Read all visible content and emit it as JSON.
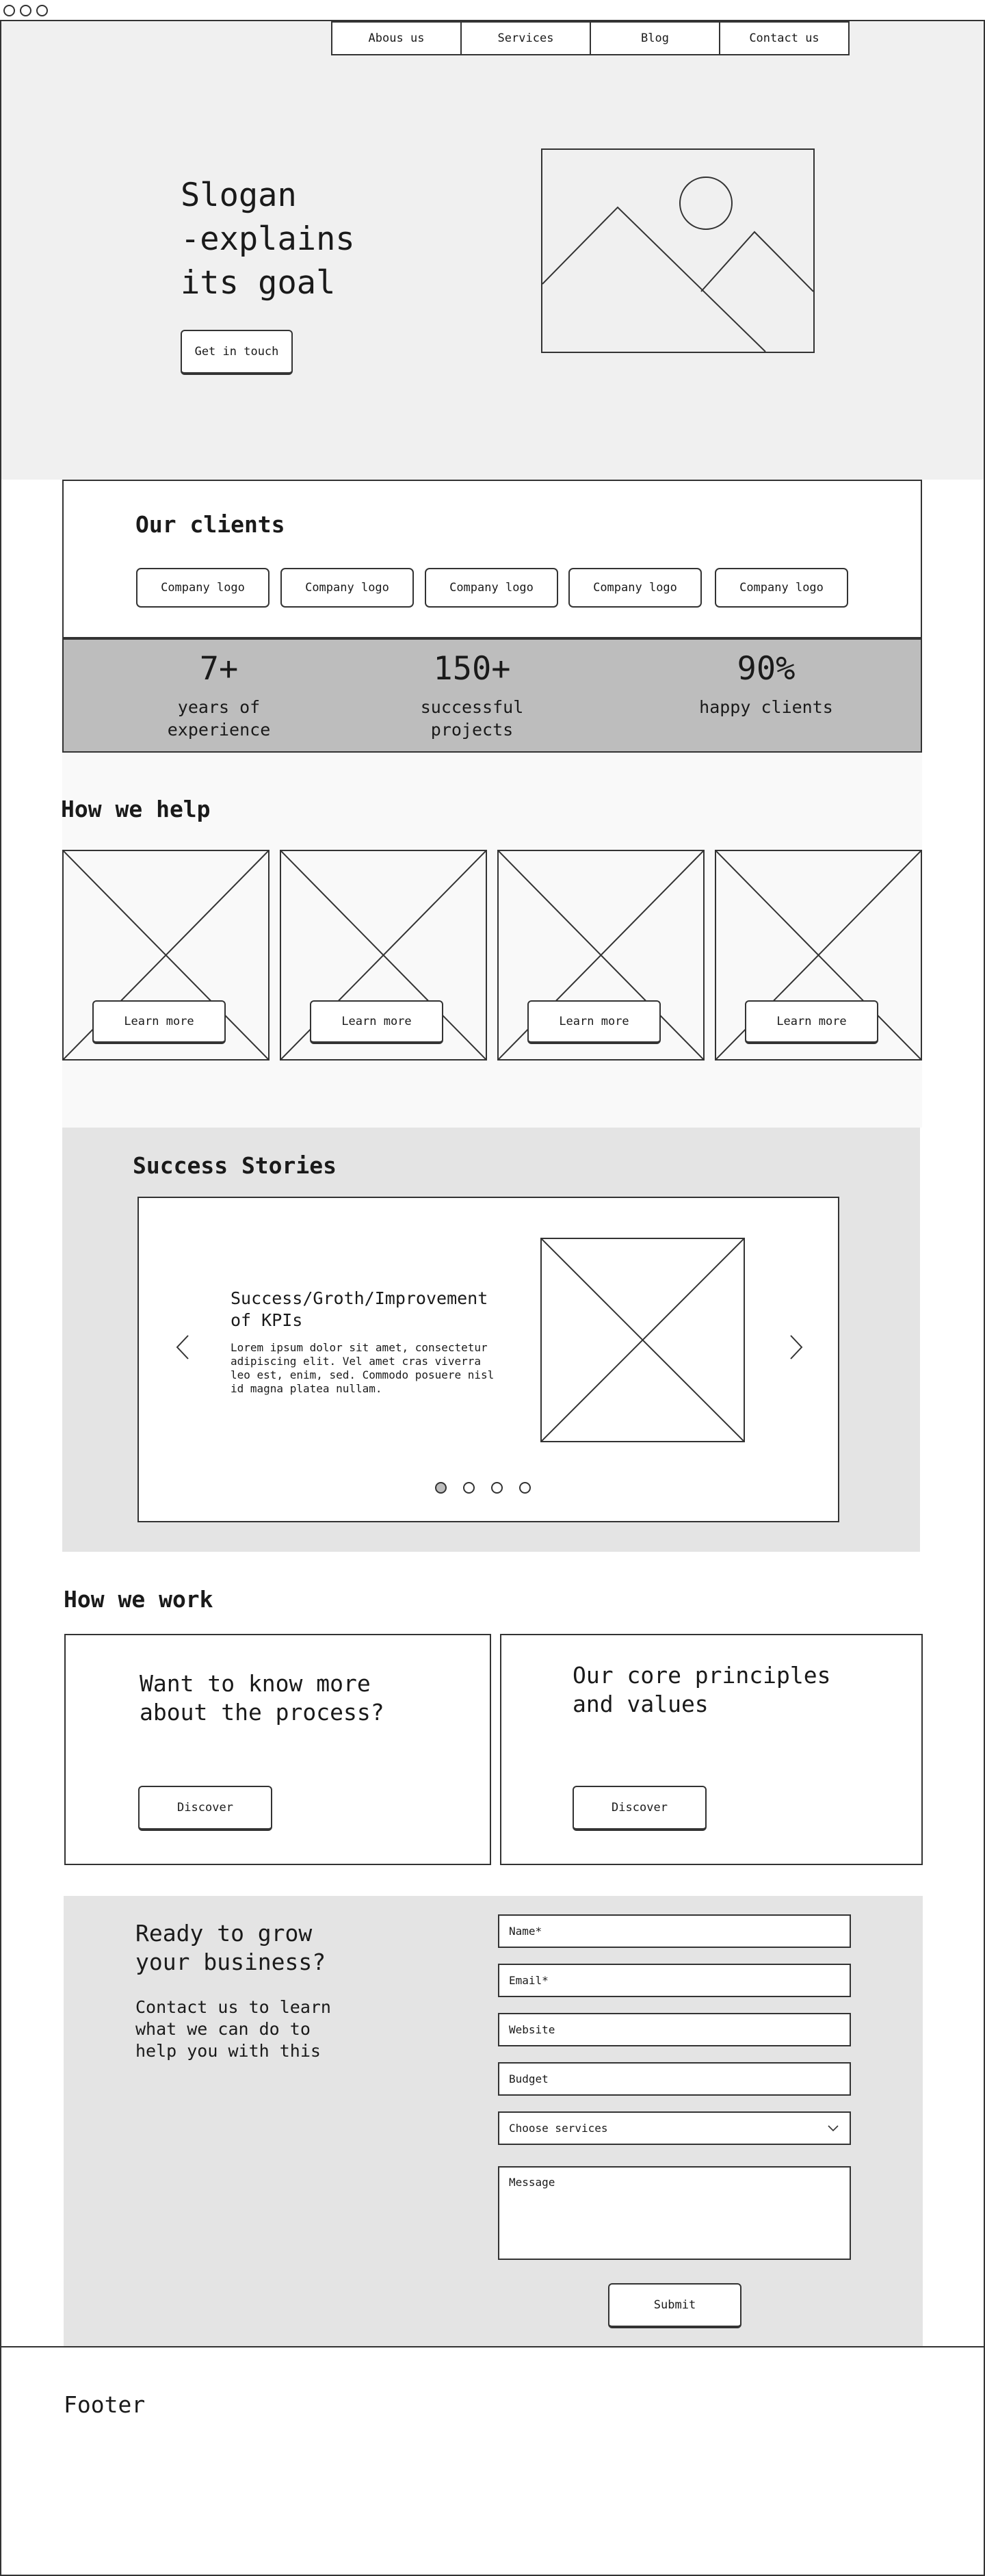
{
  "nav": {
    "items": [
      "Abous us",
      "Services",
      "Blog",
      "Contact us"
    ]
  },
  "hero": {
    "slogan": "Slogan\n-explains\nits goal",
    "cta_label": "Get in touch"
  },
  "clients": {
    "title": "Our clients",
    "logos": [
      "Company logo",
      "Company logo",
      "Company logo",
      "Company logo",
      "Company logo"
    ]
  },
  "stats": [
    {
      "value": "7+",
      "label": "years of\nexperience"
    },
    {
      "value": "150+",
      "label": "successful\nprojects"
    },
    {
      "value": "90%",
      "label": "happy clients"
    }
  ],
  "help": {
    "title": "How we help",
    "cards": [
      {
        "button": "Learn more"
      },
      {
        "button": "Learn more"
      },
      {
        "button": "Learn more"
      },
      {
        "button": "Learn more"
      }
    ]
  },
  "stories": {
    "title": "Success Stories",
    "story_title": "Success/Groth/Improvement of KPIs",
    "story_text": "Lorem ipsum dolor sit amet, consectetur adipiscing elit. Vel amet cras viverra leo est, enim, sed. Commodo posuere nisl id magna platea nullam.",
    "slide_count": 4,
    "active_slide": 1
  },
  "work": {
    "title": "How we work",
    "cards": [
      {
        "title": "Want to know more\nabout the process?",
        "button": "Discover"
      },
      {
        "title": "Our core principles\nand values",
        "button": "Discover"
      }
    ]
  },
  "contact": {
    "heading": "Ready to grow\nyour business?",
    "text": "Contact us to learn\nwhat we can do to\nhelp you with this",
    "fields": {
      "name": "Name*",
      "email": "Email*",
      "website": "Website",
      "budget": "Budget",
      "services": "Choose services",
      "message": "Message"
    },
    "submit": "Submit"
  },
  "footer": {
    "label": "Footer"
  },
  "icons": {
    "image_placeholder": "image-placeholder-icon",
    "prev": "chevron-left-icon",
    "next": "chevron-right-icon",
    "dropdown": "chevron-down-icon"
  },
  "colors": {
    "hero_bg": "#f0f0f0",
    "stats_bg": "#bdbdbd",
    "section_bg": "#e4e4e4",
    "help_bg": "#f9f9f9",
    "stroke": "#333333"
  }
}
